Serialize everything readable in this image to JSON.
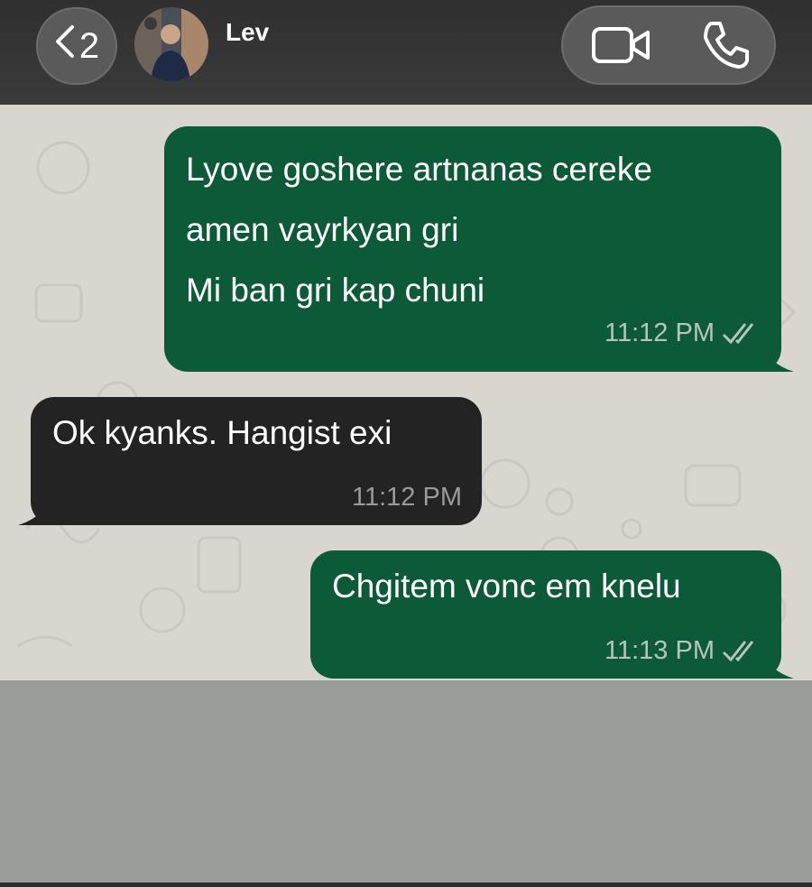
{
  "header": {
    "back_count": "2",
    "contact_name": "Lev",
    "icons": [
      "chevron-left-icon",
      "video-call-icon",
      "phone-call-icon"
    ]
  },
  "messages": [
    {
      "direction": "outgoing",
      "lines": [
        "Lyove goshere artnanas cereke",
        "amen vayrkyan gri",
        "Mi ban gri kap chuni"
      ],
      "time": "11:12 PM",
      "status": "read"
    },
    {
      "direction": "incoming",
      "lines": [
        "Ok kyanks. Hangist exi"
      ],
      "time": "11:12 PM"
    },
    {
      "direction": "outgoing",
      "lines": [
        "Chgitem vonc em knelu"
      ],
      "time": "11:13 PM",
      "status": "read"
    }
  ],
  "colors": {
    "outgoing_bubble": "#0d5a38",
    "incoming_bubble": "#232323",
    "chat_background": "#d9d6cf",
    "header_background": "#333333"
  }
}
